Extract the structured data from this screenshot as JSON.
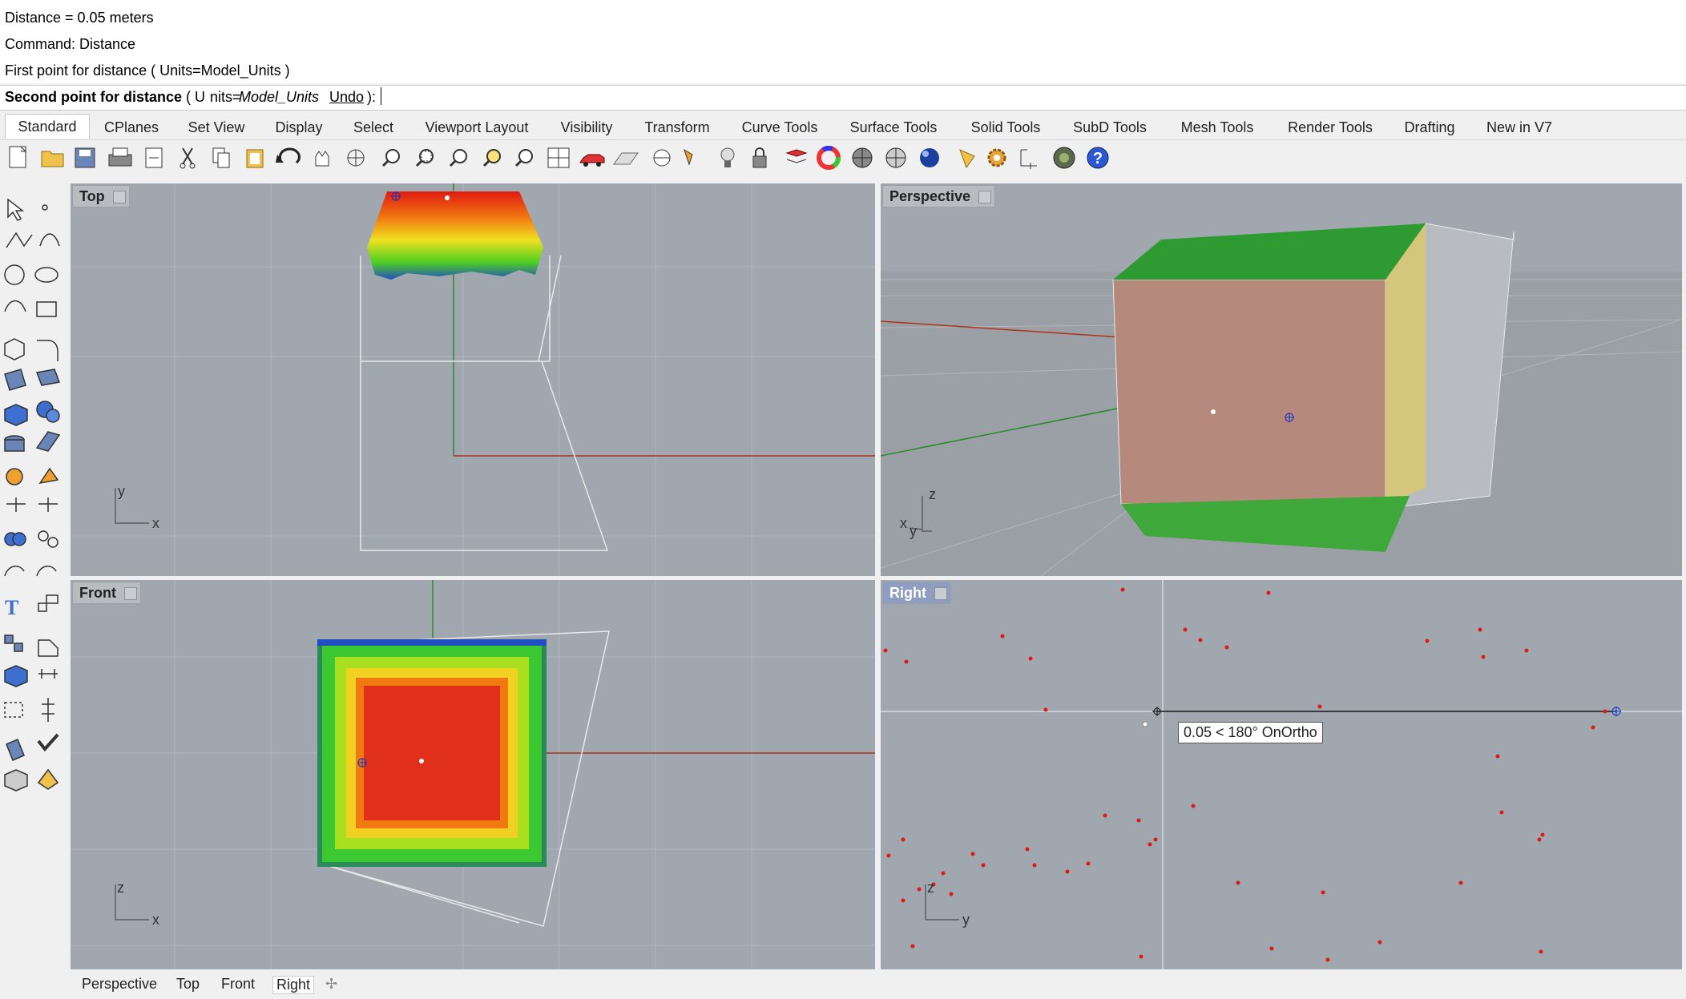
{
  "command_history": {
    "lines": [
      "Distance = 0.05 meters",
      "Command: Distance",
      "First point for distance ( Units=Model_Units )"
    ]
  },
  "command_prompt": {
    "label": "Second point for distance",
    "open_paren": "( U",
    "units_key": "nits=",
    "units_value": "Model_Units",
    "undo": "Undo",
    "close": "):"
  },
  "ribbon_tabs": [
    "Standard",
    "CPlanes",
    "Set View",
    "Display",
    "Select",
    "Viewport Layout",
    "Visibility",
    "Transform",
    "Curve Tools",
    "Surface Tools",
    "Solid Tools",
    "SubD Tools",
    "Mesh Tools",
    "Render Tools",
    "Drafting",
    "New in V7"
  ],
  "toolbar_icons": [
    "new-icon",
    "open-icon",
    "save-icon",
    "print-icon",
    "import-icon",
    "cut-icon",
    "copy-icon",
    "paste-icon",
    "undo-icon",
    "pan-icon",
    "rotate-view-icon",
    "zoom-icon",
    "zoom-window-icon",
    "zoom-extents-icon",
    "zoom-selected-icon",
    "rotate-icon",
    "four-viewports-icon",
    "car-icon",
    "grid-icon",
    "cplane-icon",
    "snap-icon",
    "light-icon",
    "lock-icon",
    "layer-icon",
    "color-wheel-icon",
    "shaded-icon",
    "rendered-icon",
    "sphere-icon",
    "spotlight-icon",
    "settings-icon",
    "dimensions-icon",
    "render-icon",
    "help-icon"
  ],
  "viewports": {
    "top": {
      "label": "Top",
      "axis_h": "x",
      "axis_v": "y"
    },
    "perspective": {
      "label": "Perspective",
      "axis_h": "y",
      "axis_v": "z",
      "axis_x": "x"
    },
    "front": {
      "label": "Front",
      "axis_h": "x",
      "axis_v": "z"
    },
    "right": {
      "label": "Right",
      "axis_h": "y",
      "axis_v": "z",
      "tooltip": "0.05 < 180° OnOrtho"
    }
  },
  "bottom_tabs": [
    "Perspective",
    "Top",
    "Front",
    "Right"
  ],
  "colors": {
    "viewport_bg": "#a1a7ae",
    "active_label": "#8e9dc0",
    "x_axis": "#b03020",
    "y_axis": "#2a8a2a"
  }
}
